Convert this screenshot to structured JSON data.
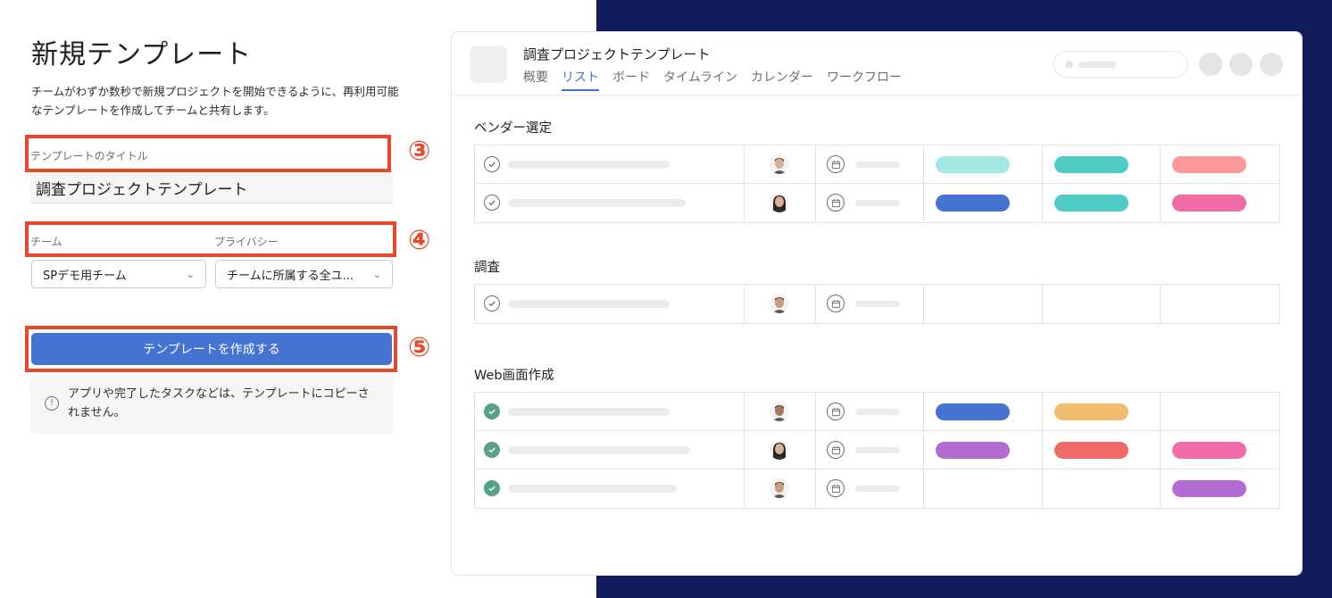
{
  "form": {
    "title": "新規テンプレート",
    "description": "チームがわずか数秒で新規プロジェクトを開始できるように、再利用可能なテンプレートを作成してチームと共有します。",
    "template_title_label": "テンプレートのタイトル",
    "template_title_value": "調査プロジェクトテンプレート",
    "team_label": "チーム",
    "privacy_label": "プライバシー",
    "team_value": "SPデモ用チーム",
    "privacy_value": "チームに所属する全ユ...",
    "create_button": "テンプレートを作成する",
    "info_text": "アプリや完了したタスクなどは、テンプレートにコピーされません。",
    "info_icon_glyph": "!"
  },
  "annotations": {
    "step3": "③",
    "step4": "④",
    "step5": "⑤"
  },
  "preview": {
    "project_name": "調査プロジェクトテンプレート",
    "tabs": [
      "概要",
      "リスト",
      "ボード",
      "タイムライン",
      "カレンダー",
      "ワークフロー"
    ],
    "active_tab": "リスト",
    "sections": [
      {
        "title": "ベンダー選定",
        "rows": [
          {
            "done": false,
            "avatar": "man-1",
            "tags": [
              "#a3e8e3",
              "#4ecbc4",
              "#fc979a"
            ]
          },
          {
            "done": false,
            "avatar": "woman-1",
            "tags": [
              "#4573d2",
              "#4ecbc4",
              "#f06ba8"
            ]
          }
        ]
      },
      {
        "title": "調査",
        "rows": [
          {
            "done": false,
            "avatar": "man-2",
            "tags": [
              "",
              "",
              ""
            ]
          }
        ]
      },
      {
        "title": "Web画面作成",
        "rows": [
          {
            "done": true,
            "avatar": "man-3",
            "tags": [
              "#4573d2",
              "#f1bd6c",
              ""
            ]
          },
          {
            "done": true,
            "avatar": "woman-1",
            "tags": [
              "#b36bd4",
              "#f06a6a",
              "#f06ba8"
            ]
          },
          {
            "done": true,
            "avatar": "man-2",
            "tags": [
              "",
              "",
              "#b36bd4"
            ]
          }
        ]
      }
    ]
  },
  "colors": {
    "accent": "#4573d2",
    "annotation_red": "#e8472a",
    "background_navy": "#121b5c",
    "done_green": "#58a182"
  }
}
